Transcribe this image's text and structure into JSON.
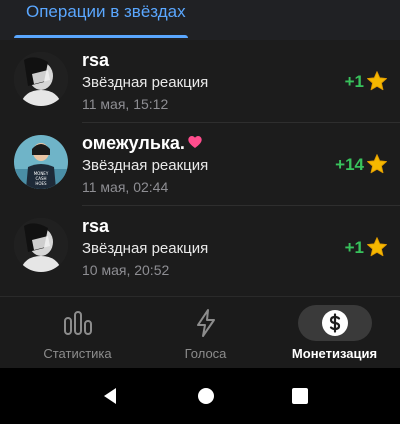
{
  "tabs": {
    "active_label": "Операции в звёздах"
  },
  "transactions": [
    {
      "name": "rsa",
      "subtitle": "Звёздная реакция",
      "time": "11 мая, 15:12",
      "amount": "+1",
      "has_heart": false
    },
    {
      "name": "омежулька.",
      "subtitle": "Звёздная реакция",
      "time": "11 мая, 02:44",
      "amount": "+14",
      "has_heart": true
    },
    {
      "name": "rsa",
      "subtitle": "Звёздная реакция",
      "time": "10 мая, 20:52",
      "amount": "+1",
      "has_heart": false
    }
  ],
  "avatar_texts": [
    "MONEY",
    "CASH",
    "HOES"
  ],
  "bottom_nav": [
    {
      "label": "Статистика",
      "icon": "bar-chart-icon",
      "active": false
    },
    {
      "label": "Голоса",
      "icon": "lightning-bolt-icon",
      "active": false
    },
    {
      "label": "Монетизация",
      "icon": "dollar-coin-icon",
      "active": true
    }
  ],
  "system_nav": [
    "back-icon",
    "home-icon",
    "recents-icon"
  ],
  "colors": {
    "accent": "#5aa7ff",
    "amount_positive": "#38c25c",
    "star": "#f5b800",
    "background": "#1e1e1e"
  }
}
